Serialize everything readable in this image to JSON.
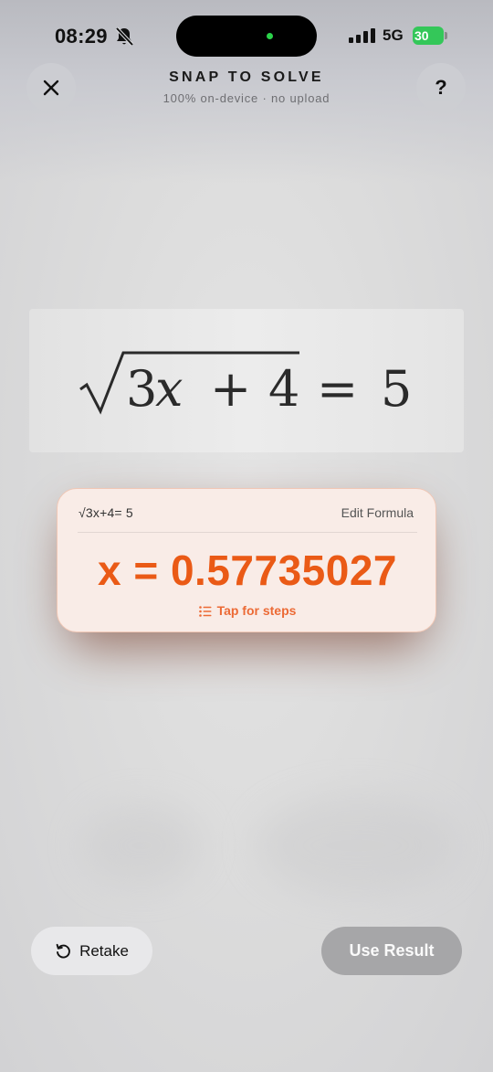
{
  "status_bar": {
    "time": "08:29",
    "network": "5G",
    "battery": "30"
  },
  "header": {
    "title": "SNAP TO SOLVE",
    "subtitle": "100% on-device · no upload",
    "help_label": "?"
  },
  "capture": {
    "formula_parts": {
      "radicand_number": "3",
      "variable": "x",
      "plus": "+",
      "constant": "4",
      "equals": "=",
      "rhs": "5"
    }
  },
  "result": {
    "formula": "√3x+4=  5",
    "edit_label": "Edit Formula",
    "answer": "x = 0.57735027",
    "steps_label": "Tap for steps"
  },
  "actions": {
    "retake_label": "Retake",
    "use_result_label": "Use Result"
  },
  "colors": {
    "accent": "#ea5a16",
    "battery_green": "#34c759",
    "camera_indicator": "#2bd24a"
  },
  "icons": [
    "bell-slash-icon",
    "signal-icon",
    "battery-icon",
    "close-icon",
    "list-icon",
    "retake-icon"
  ]
}
